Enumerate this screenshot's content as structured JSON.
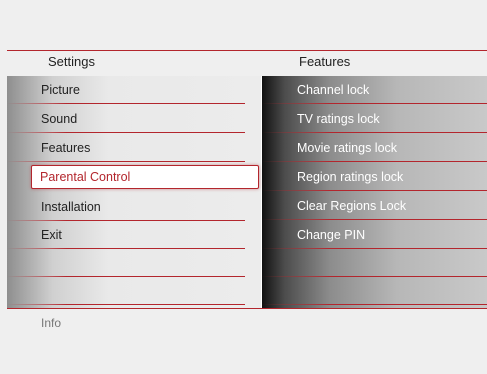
{
  "header": {
    "left_title": "Settings",
    "right_title": "Features"
  },
  "settings_menu": {
    "items": [
      {
        "label": "Picture"
      },
      {
        "label": "Sound"
      },
      {
        "label": "Features"
      },
      {
        "label": "Parental Control",
        "selected": true
      },
      {
        "label": "Installation"
      },
      {
        "label": "Exit"
      }
    ]
  },
  "features_menu": {
    "items": [
      {
        "label": "Channel lock"
      },
      {
        "label": "TV ratings lock"
      },
      {
        "label": "Movie ratings lock"
      },
      {
        "label": "Region ratings lock"
      },
      {
        "label": "Clear Regions Lock"
      },
      {
        "label": "Change PIN"
      }
    ]
  },
  "info": {
    "label": "Info"
  },
  "colors": {
    "accent": "#b3262d",
    "background": "#efefef"
  }
}
